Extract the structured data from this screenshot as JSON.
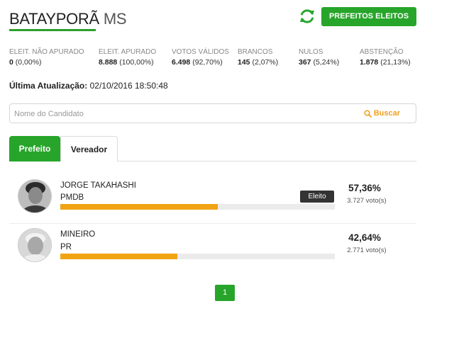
{
  "header": {
    "city": "BATAYPORÃ",
    "state": "MS",
    "refresh_icon": "refresh-icon",
    "elected_button_label": "PREFEITOS ELEITOS",
    "accent_color": "#27a52a"
  },
  "stats": [
    {
      "label": "ELEIT. NÃO APURADO",
      "value": "0",
      "pct": "(0,00%)"
    },
    {
      "label": "ELEIT. APURADO",
      "value": "8.888",
      "pct": "(100,00%)"
    },
    {
      "label": "VOTOS VÁLIDOS",
      "value": "6.498",
      "pct": "(92,70%)"
    },
    {
      "label": "BRANCOS",
      "value": "145",
      "pct": "(2,07%)"
    },
    {
      "label": "NULOS",
      "value": "367",
      "pct": "(5,24%)"
    },
    {
      "label": "ABSTENÇÃO",
      "value": "1.878",
      "pct": "(21,13%)"
    }
  ],
  "update": {
    "label": "Última Atualização:",
    "datetime": "02/10/2016 18:50:48"
  },
  "search": {
    "placeholder": "Nome do Candidato",
    "button_label": "Buscar",
    "icon": "search-icon"
  },
  "tabs": [
    {
      "label": "Prefeito",
      "active": true
    },
    {
      "label": "Vereador",
      "active": false
    }
  ],
  "candidates": [
    {
      "name": "JORGE TAKAHASHI",
      "party": "PMDB",
      "percent": "57,36%",
      "percent_value": 57.36,
      "votes": "3.727 voto(s)",
      "elected_label": "Eleito",
      "bar_color": "#f0a414"
    },
    {
      "name": "MINEIRO",
      "party": "PR",
      "percent": "42,64%",
      "percent_value": 42.64,
      "votes": "2.771 voto(s)",
      "bar_color": "#f0a414"
    }
  ],
  "pagination": {
    "current": "1"
  }
}
